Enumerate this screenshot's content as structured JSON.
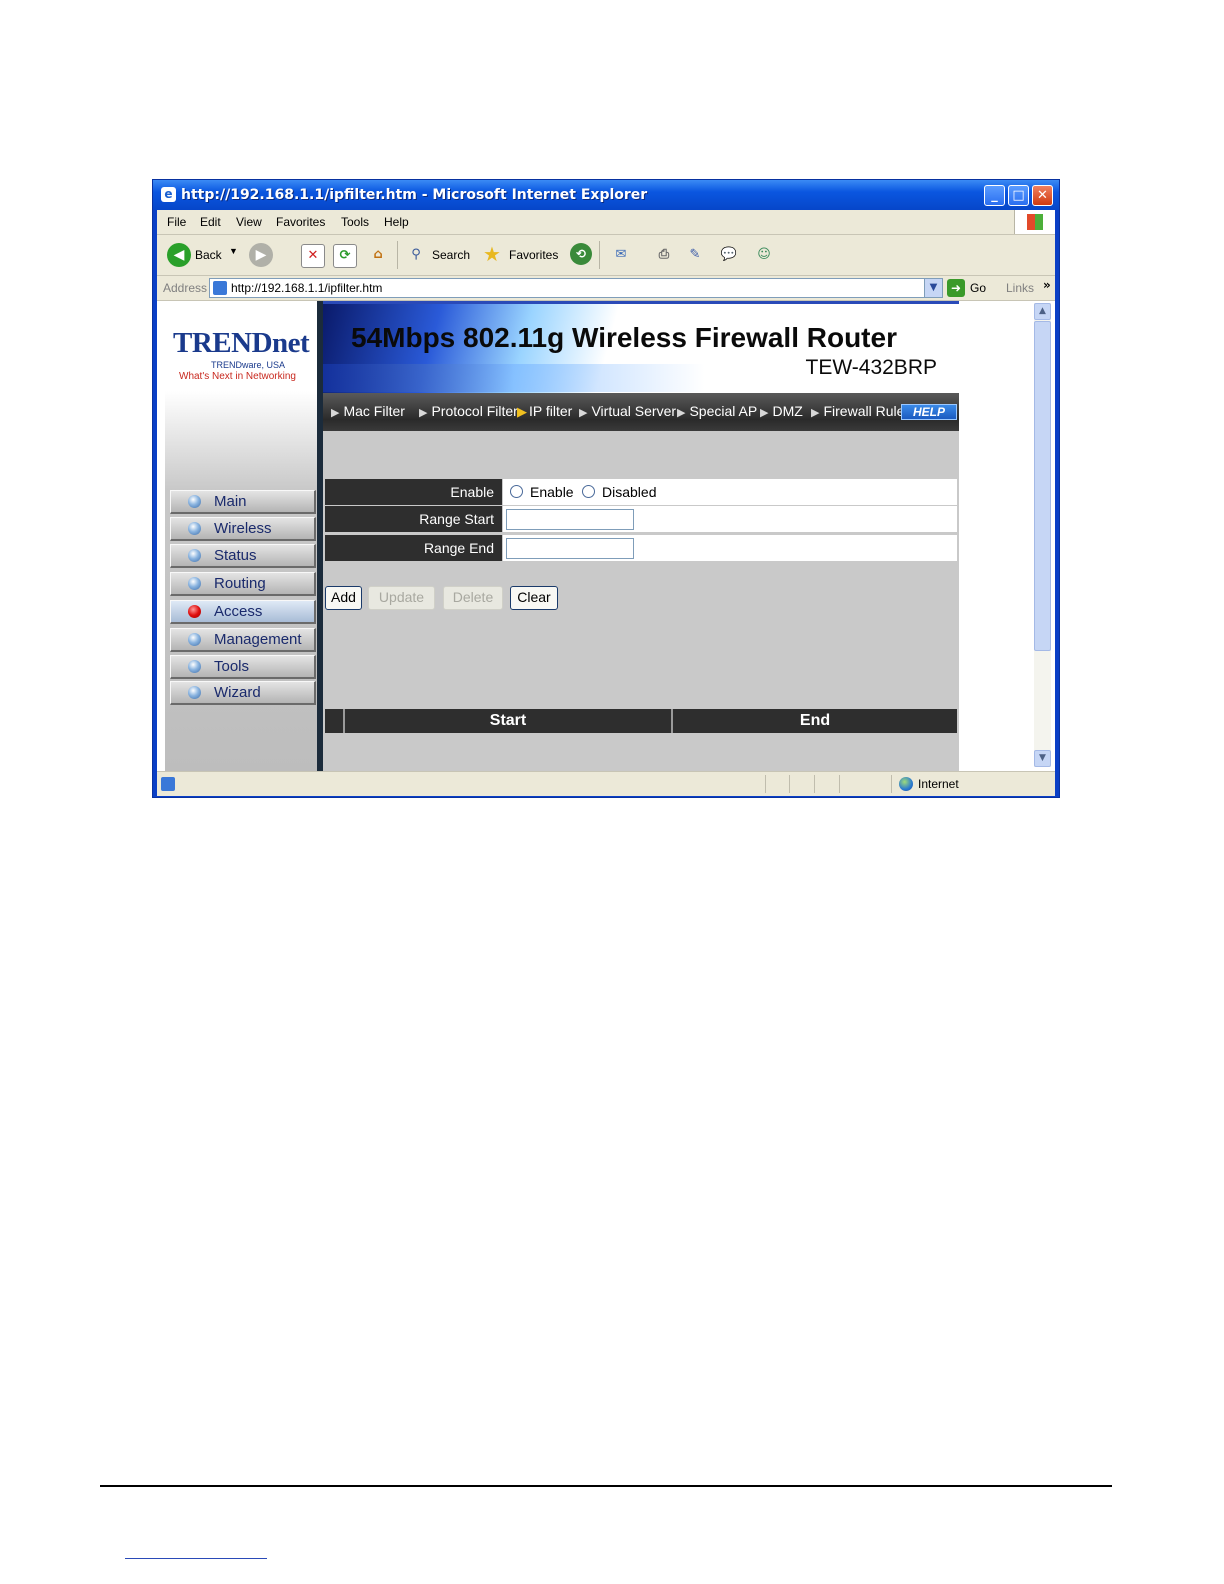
{
  "window": {
    "title": "http://192.168.1.1/ipfilter.htm - Microsoft Internet Explorer",
    "controls": [
      "_",
      "□",
      "✕"
    ]
  },
  "menu": [
    "File",
    "Edit",
    "View",
    "Favorites",
    "Tools",
    "Help"
  ],
  "toolbar": {
    "back_label": "Back",
    "search_label": "Search",
    "favorites_label": "Favorites"
  },
  "address": {
    "label": "Address",
    "url": "http://192.168.1.1/ipfilter.htm",
    "go_label": "Go",
    "links_label": "Links"
  },
  "router": {
    "logo": "TRENDnet",
    "logo_sub": "TRENDware, USA",
    "logo_tag": "What's Next in Networking",
    "banner_title": "54Mbps 802.11g Wireless Firewall Router",
    "model": "TEW-432BRP",
    "help_label": "HELP",
    "nav": [
      {
        "label": "Main",
        "active": false
      },
      {
        "label": "Wireless",
        "active": false
      },
      {
        "label": "Status",
        "active": false
      },
      {
        "label": "Routing",
        "active": false
      },
      {
        "label": "Access",
        "active": true
      },
      {
        "label": "Management",
        "active": false
      },
      {
        "label": "Tools",
        "active": false
      },
      {
        "label": "Wizard",
        "active": false
      }
    ],
    "subnav": [
      "Mac Filter",
      "Protocol Filter",
      "IP filter",
      "Virtual Server",
      "Special AP",
      "DMZ",
      "Firewall Rule"
    ],
    "subnav_active": "IP filter"
  },
  "form": {
    "enable_label": "Enable",
    "radio_enable": "Enable",
    "radio_disabled": "Disabled",
    "range_start_label": "Range Start",
    "range_end_label": "Range End",
    "range_start_value": "",
    "range_end_value": ""
  },
  "buttons": {
    "add": "Add",
    "update": "Update",
    "delete": "Delete",
    "clear": "Clear"
  },
  "table": {
    "columns": [
      "",
      "Start",
      "End"
    ]
  },
  "status": {
    "zone": "Internet"
  },
  "colors": {
    "xp_blue": "#0a56e0",
    "panel_dark": "#2e2e2e",
    "content_gray": "#c9c9c9",
    "active_nav_dot": "#e01010"
  }
}
